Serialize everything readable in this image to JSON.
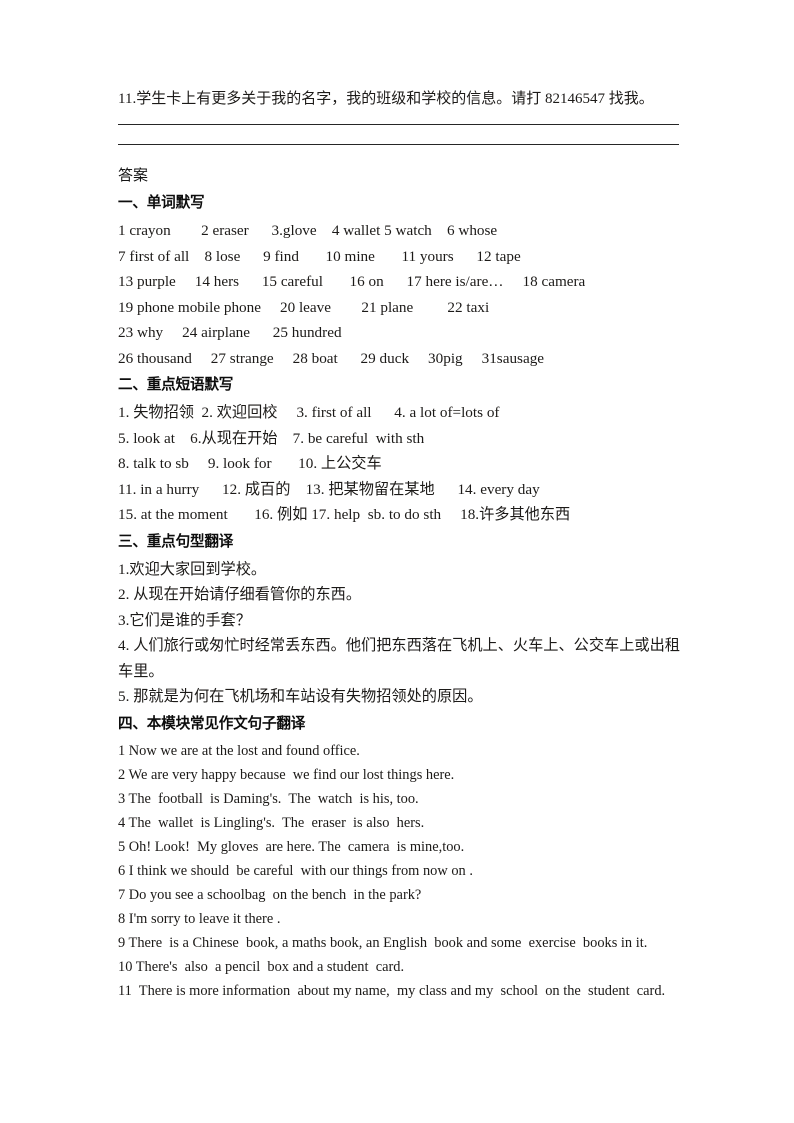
{
  "document": {
    "intro_question": "11.学生卡上有更多关于我的名字，我的班级和学校的信息。请打 82146547 找我。",
    "answers_heading": "答案",
    "sections": [
      {
        "heading": "一、单词默写",
        "lines": [
          "1 crayon        2 eraser      3.glove    4 wallet 5 watch    6 whose",
          "7 first of all    8 lose      9 find       10 mine       11 yours      12 tape",
          "13 purple     14 hers      15 careful       16 on      17 here is/are…     18 camera",
          "19 phone mobile phone     20 leave        21 plane         22 taxi",
          "23 why     24 airplane      25 hundred",
          "26 thousand     27 strange     28 boat      29 duck     30pig     31sausage"
        ]
      },
      {
        "heading": "二、重点短语默写",
        "lines": [
          "1. 失物招领  2. 欢迎回校     3. first of all      4. a lot of=lots of",
          "5. look at    6.从现在开始    7. be careful  with sth",
          "8. talk to sb     9. look for       10. 上公交车",
          "11. in a hurry      12. 成百的    13. 把某物留在某地      14. every day",
          "15. at the moment       16. 例如 17. help  sb. to do sth     18.许多其他东西"
        ]
      },
      {
        "heading": "三、重点句型翻译",
        "lines": [
          "1.欢迎大家回到学校。",
          "2. 从现在开始请仔细看管你的东西。",
          "3.它们是谁的手套？",
          "4. 人们旅行或匆忙时经常丢东西。他们把东西落在飞机上、火车上、公交车上或出租",
          "车里。",
          "5. 那就是为何在飞机场和车站设有失物招领处的原因。"
        ]
      },
      {
        "heading": "四、本模块常见作文句子翻译",
        "lines": [
          "1 Now we are at the lost and found office.",
          "2 We are very happy because  we find our lost things here.",
          "3 The  football  is Daming's.  The  watch  is his, too.",
          "4 The  wallet  is Lingling's.  The  eraser  is also  hers.",
          "5 Oh! Look!  My gloves  are here. The  camera  is mine,too.",
          "6 I think we should  be careful  with our things from now on .",
          "7 Do you see a schoolbag  on the bench  in the park?",
          "8 I'm sorry to leave it there .",
          "9 There  is a Chinese  book, a maths book, an English  book and some  exercise  books in it.",
          "10 There's  also  a pencil  box and a student  card.",
          "11  There is more information  about my name,  my class and my  school  on the  student  card."
        ]
      }
    ]
  }
}
